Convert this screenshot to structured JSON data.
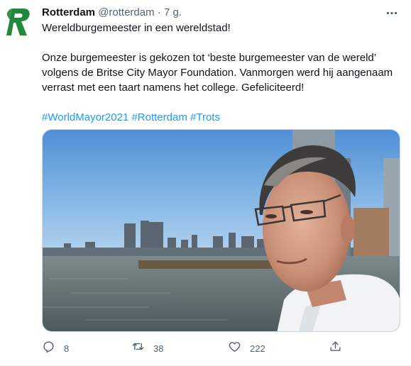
{
  "tweet": {
    "author_name": "Rotterdam",
    "handle": "@rotterdam",
    "separator": "·",
    "time": "7 g.",
    "lines": [
      "Wereldburgemeester in een wereldstad!",
      "Onze burgemeester is gekozen tot ‘beste burgemeester van de wereld’",
      "volgens de Britse City Mayor Foundation. Vanmorgen werd hij aangenaam",
      "verrast met een taart namens het college. Gefeliciteerd!"
    ],
    "hashtags": [
      "#WorldMayor2021",
      "#Rotterdam",
      "#Trots"
    ]
  },
  "actions": {
    "reply_count": "8",
    "retweet_count": "38",
    "like_count": "222"
  },
  "icons": {
    "avatar": "rotterdam-logo-icon",
    "more": "more-dots-icon",
    "reply": "reply-icon",
    "retweet": "retweet-icon",
    "like": "heart-icon",
    "share": "share-icon"
  },
  "colors": {
    "accent": "#1d9bf0",
    "logo_green": "#1f8a3b",
    "secondary_text": "#536471"
  }
}
